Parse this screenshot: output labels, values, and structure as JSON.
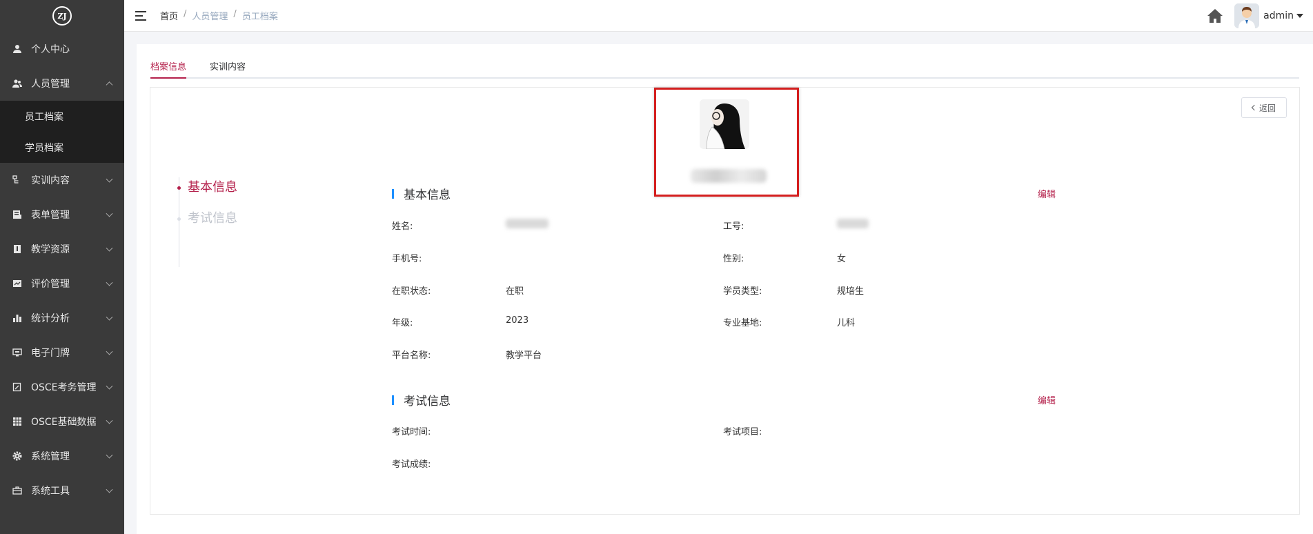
{
  "sidebar": {
    "logo_text": "ZJ",
    "items": [
      {
        "label": "个人中心",
        "icon": "user-icon",
        "expanded": false,
        "has_children": false
      },
      {
        "label": "人员管理",
        "icon": "users-icon",
        "expanded": true,
        "has_children": true,
        "children": [
          {
            "label": "员工档案"
          },
          {
            "label": "学员档案"
          }
        ]
      },
      {
        "label": "实训内容",
        "icon": "flow-icon",
        "expanded": false,
        "has_children": true
      },
      {
        "label": "表单管理",
        "icon": "form-icon",
        "expanded": false,
        "has_children": true
      },
      {
        "label": "教学资源",
        "icon": "book-icon",
        "expanded": false,
        "has_children": true
      },
      {
        "label": "评价管理",
        "icon": "chart-box-icon",
        "expanded": false,
        "has_children": true
      },
      {
        "label": "统计分析",
        "icon": "bar-chart-icon",
        "expanded": false,
        "has_children": true
      },
      {
        "label": "电子门牌",
        "icon": "monitor-icon",
        "expanded": false,
        "has_children": true
      },
      {
        "label": "OSCE考务管理",
        "icon": "edit-doc-icon",
        "expanded": false,
        "has_children": true
      },
      {
        "label": "OSCE基础数据",
        "icon": "grid-icon",
        "expanded": false,
        "has_children": true
      },
      {
        "label": "系统管理",
        "icon": "gear-icon",
        "expanded": false,
        "has_children": true
      },
      {
        "label": "系统工具",
        "icon": "toolbox-icon",
        "expanded": false,
        "has_children": true
      }
    ]
  },
  "topbar": {
    "breadcrumb": [
      "首页",
      "人员管理",
      "员工档案"
    ],
    "username": "admin"
  },
  "tabs": [
    {
      "label": "档案信息",
      "active": true
    },
    {
      "label": "实训内容",
      "active": false
    }
  ],
  "back_label": "返回",
  "timeline": [
    {
      "label": "基本信息",
      "active": true
    },
    {
      "label": "考试信息",
      "active": false
    }
  ],
  "basic": {
    "title": "基本信息",
    "edit": "编辑",
    "fields": {
      "name_label": "姓名:",
      "name_value": "",
      "jobno_label": "工号:",
      "jobno_value": "",
      "phone_label": "手机号:",
      "phone_value": "",
      "gender_label": "性别:",
      "gender_value": "女",
      "status_label": "在职状态:",
      "status_value": "在职",
      "type_label": "学员类型:",
      "type_value": "规培生",
      "grade_label": "年级:",
      "grade_value": "2023",
      "base_label": "专业基地:",
      "base_value": "儿科",
      "platform_label": "平台名称:",
      "platform_value": "教学平台"
    }
  },
  "exam": {
    "title": "考试信息",
    "edit": "编辑",
    "fields": {
      "time_label": "考试时间:",
      "time_value": "",
      "project_label": "考试项目:",
      "project_value": "",
      "score_label": "考试成绩:",
      "score_value": ""
    }
  },
  "colors": {
    "accent": "#b4204b",
    "sidebar_bg": "#3a3a3a",
    "submenu_bg": "#1f1f1f",
    "section_bar": "#1e90ff",
    "highlight_border": "#d41e1e"
  }
}
